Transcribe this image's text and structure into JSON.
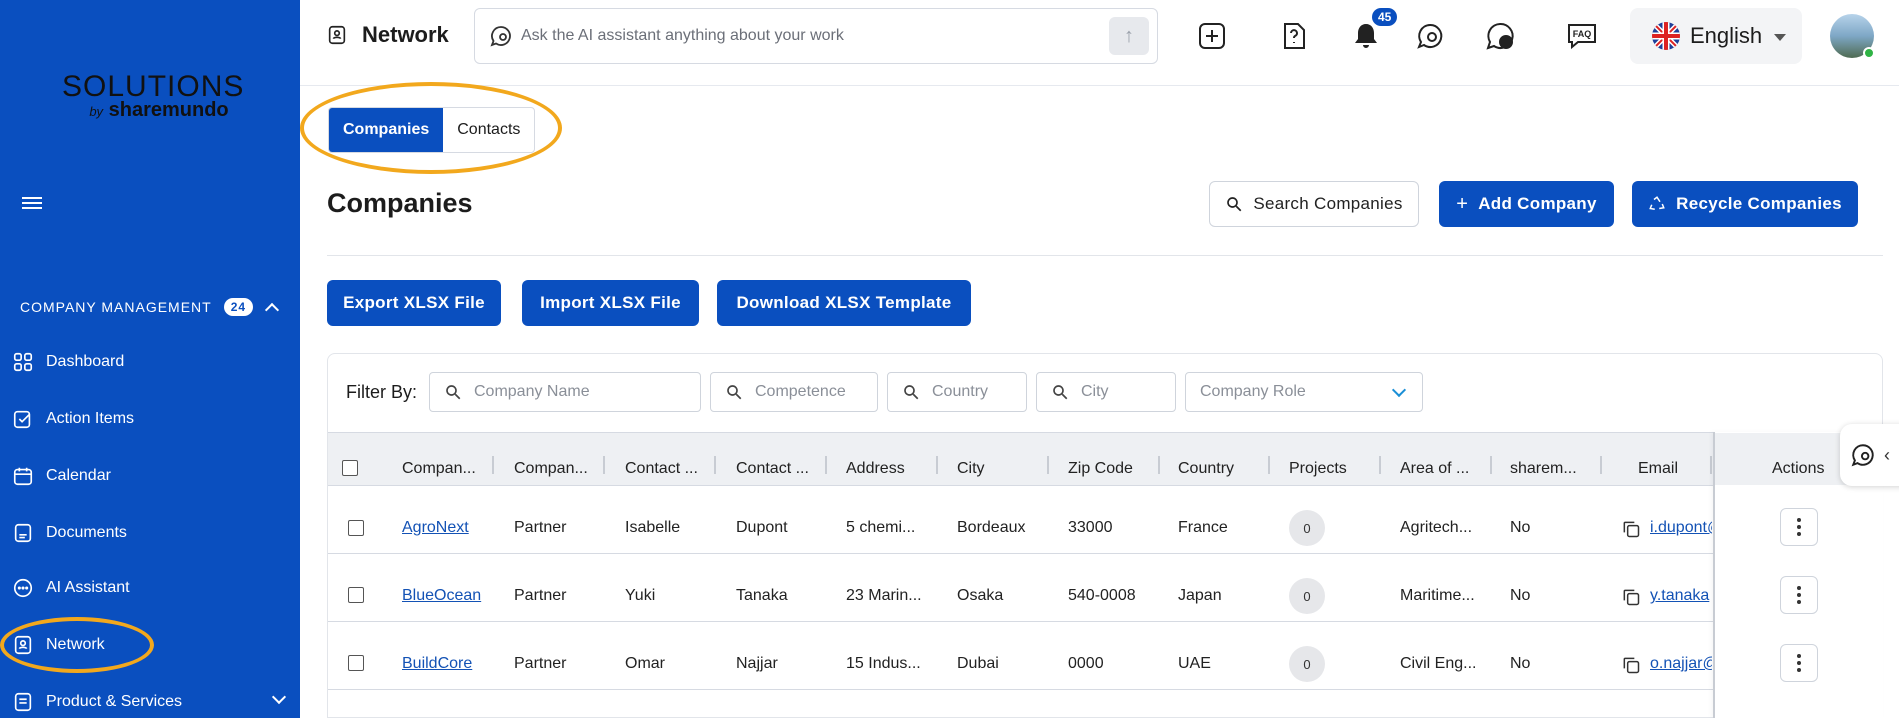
{
  "sidebar": {
    "logo_main": "SOLUTIONS",
    "logo_by": "by",
    "logo_brand": "sharemundo",
    "section_label": "COMPANY MANAGEMENT",
    "section_count": "24",
    "items": [
      {
        "label": "Dashboard",
        "icon": "dashboard-icon"
      },
      {
        "label": "Action Items",
        "icon": "action-items-icon"
      },
      {
        "label": "Calendar",
        "icon": "calendar-icon"
      },
      {
        "label": "Documents",
        "icon": "documents-icon"
      },
      {
        "label": "AI Assistant",
        "icon": "ai-assistant-icon"
      },
      {
        "label": "Network",
        "icon": "network-icon"
      },
      {
        "label": "Product & Services",
        "icon": "product-services-icon"
      }
    ]
  },
  "header": {
    "title": "Network",
    "ask_placeholder": "Ask the AI assistant anything about your work",
    "notification_count": "45",
    "faq_label": "FAQ",
    "language": "English"
  },
  "tabs": [
    {
      "label": "Companies",
      "active": true
    },
    {
      "label": "Contacts",
      "active": false
    }
  ],
  "page": {
    "title": "Companies",
    "search_button": "Search Companies",
    "add_button": "Add Company",
    "recycle_button": "Recycle Companies",
    "export_button": "Export XLSX File",
    "import_button": "Import XLSX File",
    "template_button": "Download XLSX Template"
  },
  "filters": {
    "label": "Filter By:",
    "company_name": "Company Name",
    "competence": "Competence",
    "country": "Country",
    "city": "City",
    "company_role": "Company Role"
  },
  "table": {
    "columns": [
      "Compan...",
      "Compan...",
      "Contact ...",
      "Contact ...",
      "Address",
      "City",
      "Zip Code",
      "Country",
      "Projects",
      "Area of ...",
      "sharem...",
      "Email",
      "Actions"
    ],
    "rows": [
      {
        "company": "AgroNext",
        "role": "Partner",
        "first": "Isabelle",
        "last": "Dupont",
        "address": "5 chemi...",
        "city": "Bordeaux",
        "zip": "33000",
        "country": "France",
        "projects": "0",
        "area": "Agritech...",
        "sharemundo": "No",
        "email": "i.dupont@"
      },
      {
        "company": "BlueOcean",
        "role": "Partner",
        "first": "Yuki",
        "last": "Tanaka",
        "address": "23 Marin...",
        "city": "Osaka",
        "zip": "540-0008",
        "country": "Japan",
        "projects": "0",
        "area": "Maritime...",
        "sharemundo": "No",
        "email": "y.tanaka"
      },
      {
        "company": "BuildCore",
        "role": "Partner",
        "first": "Omar",
        "last": "Najjar",
        "address": "15 Indus...",
        "city": "Dubai",
        "zip": "0000",
        "country": "UAE",
        "projects": "0",
        "area": "Civil Eng...",
        "sharemundo": "No",
        "email": "o.najjar@"
      }
    ]
  },
  "colors": {
    "brand_blue": "#0a4fbf",
    "highlight_ring": "#f2a81d",
    "link": "#1352b5"
  }
}
